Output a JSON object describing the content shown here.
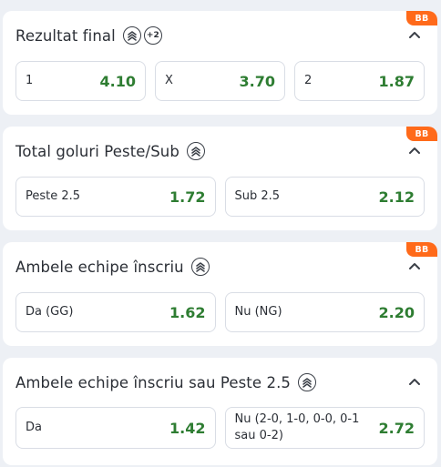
{
  "markets": [
    {
      "title": "Rezultat final",
      "badge": "BB",
      "extra_count": "+2",
      "icons": [
        "stack-icon",
        "chevron-up-icon"
      ],
      "outcomes": [
        {
          "label": "1",
          "odd": "4.10"
        },
        {
          "label": "X",
          "odd": "3.70"
        },
        {
          "label": "2",
          "odd": "1.87"
        }
      ]
    },
    {
      "title": "Total goluri Peste/Sub",
      "badge": "BB",
      "outcomes": [
        {
          "label": "Peste 2.5",
          "odd": "1.72"
        },
        {
          "label": "Sub 2.5",
          "odd": "2.12"
        }
      ]
    },
    {
      "title": "Ambele echipe înscriu",
      "badge": "BB",
      "outcomes": [
        {
          "label": "Da (GG)",
          "odd": "1.62"
        },
        {
          "label": "Nu (NG)",
          "odd": "2.20"
        }
      ]
    },
    {
      "title": "Ambele echipe înscriu sau Peste 2.5",
      "outcomes": [
        {
          "label": "Da",
          "odd": "1.42"
        },
        {
          "label": "Nu (2-0, 1-0, 0-0, 0-1 sau 0-2)",
          "odd": "2.72"
        }
      ]
    }
  ],
  "colors": {
    "odd_value": "#2e7d32",
    "badge_bg": "#ff6a1a",
    "page_bg": "#edf0f5"
  }
}
